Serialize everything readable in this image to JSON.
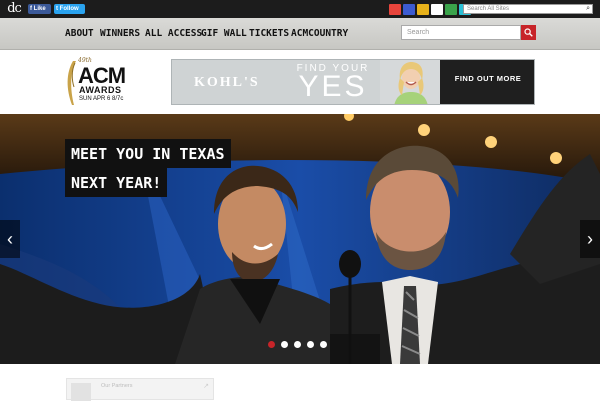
{
  "topbar": {
    "logo_text": "dc",
    "facebook_like": "Like",
    "twitter_follow": "Follow",
    "network_icons": [
      {
        "name": "site-logo-1-icon",
        "color": "#e8453c"
      },
      {
        "name": "site-logo-2-icon",
        "color": "#3c5bd1"
      },
      {
        "name": "site-logo-3-icon",
        "color": "#e8b21b"
      },
      {
        "name": "site-logo-4-icon",
        "color": "#ffffff"
      },
      {
        "name": "site-logo-5-icon",
        "color": "#3aa34b"
      },
      {
        "name": "site-logo-6-icon",
        "color": "#2ac0d6"
      }
    ],
    "search_placeholder": "Search All Sites"
  },
  "nav": {
    "items": [
      "ABOUT",
      "WINNERS",
      "ALL ACCESS",
      "GIF WALL",
      "TICKETS",
      "ACMCOUNTRY"
    ],
    "search_placeholder": "Search",
    "accent": "#c72429"
  },
  "header": {
    "logo": {
      "small": "49th",
      "big": "ACM",
      "awards": "AWARDS",
      "date": "SUN APR 6 8/7c"
    },
    "ad": {
      "brand": "KOHL'S",
      "headline_top": "FIND YOUR",
      "headline_big": "YES",
      "cta": "FIND OUT MORE"
    }
  },
  "hero": {
    "caption_line1": "MEET YOU IN TEXAS",
    "caption_line2": "NEXT YEAR!",
    "prev_arrow": "‹",
    "next_arrow": "›",
    "slide_count": 5,
    "active_slide": 1
  },
  "teaser": {
    "label": "Our Partners",
    "ext_icon": "↗"
  }
}
